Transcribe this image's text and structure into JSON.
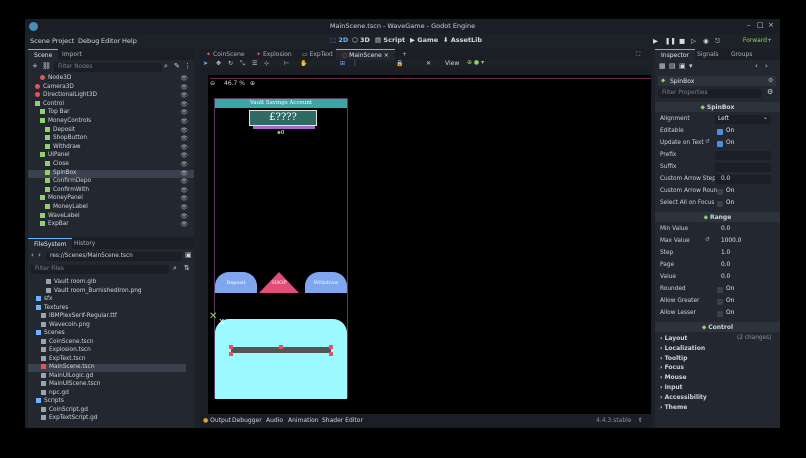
{
  "window": {
    "title": "MainScene.tscn - WaveGame - Godot Engine"
  },
  "menu": [
    "Scene",
    "Project",
    "Debug",
    "Editor",
    "Help"
  ],
  "modes": {
    "m2d": "2D",
    "m3d": "3D",
    "script": "Script",
    "game": "Game",
    "assetlib": "AssetLib"
  },
  "renderer": "Forward+",
  "scene_dock": {
    "tabs": [
      "Scene",
      "Import"
    ],
    "filter_placeholder": "Filter Nodes",
    "nodes": [
      {
        "label": "Node3D",
        "color": "#e05757"
      },
      {
        "label": "Camera3D",
        "color": "#e05757"
      },
      {
        "label": "DirectionalLight3D",
        "color": "#e05757"
      },
      {
        "label": "Control",
        "color": "#8fd16b"
      },
      {
        "label": "Top Bar",
        "color": "#8fd16b"
      },
      {
        "label": "MoneyControls",
        "color": "#8fd16b"
      },
      {
        "label": "Deposit",
        "color": "#8fd16b"
      },
      {
        "label": "ShopButton",
        "color": "#8fd16b"
      },
      {
        "label": "Withdraw",
        "color": "#8fd16b"
      },
      {
        "label": "UIPanel",
        "color": "#8fd16b"
      },
      {
        "label": "Close",
        "color": "#8fd16b"
      },
      {
        "label": "SpinBox",
        "color": "#8fd16b"
      },
      {
        "label": "ConfirmDepo",
        "color": "#8fd16b"
      },
      {
        "label": "ConfirmWith",
        "color": "#8fd16b"
      },
      {
        "label": "MoneyPanel",
        "color": "#8fd16b"
      },
      {
        "label": "MoneyLabel",
        "color": "#8fd16b"
      },
      {
        "label": "WaveLabel",
        "color": "#8fd16b"
      },
      {
        "label": "ExpBar",
        "color": "#8fd16b"
      }
    ]
  },
  "filesystem": {
    "tabs": [
      "FileSystem",
      "History"
    ],
    "path": "res://Scenes/MainScene.tscn",
    "filter_placeholder": "Filter Files",
    "items": [
      {
        "label": "Vault room.glb"
      },
      {
        "label": "Vault room_BurnishedIron.png"
      },
      {
        "label": "sfx"
      },
      {
        "label": "Textures"
      },
      {
        "label": "IBMPlexSerif-Regular.ttf"
      },
      {
        "label": "Wavecoin.png"
      },
      {
        "label": "Scenes"
      },
      {
        "label": "CoinScene.tscn"
      },
      {
        "label": "Explosion.tscn"
      },
      {
        "label": "ExpText.tscn"
      },
      {
        "label": "MainScene.tscn"
      },
      {
        "label": "MainUILogic.gd"
      },
      {
        "label": "MainUIScene.tscn"
      },
      {
        "label": "npc.gd"
      },
      {
        "label": "Scripts"
      },
      {
        "label": "CoinScript.gd"
      },
      {
        "label": "ExpTextScript.gd"
      }
    ]
  },
  "editor_tabs": [
    "CoinScene",
    "Explosion",
    "ExpText",
    "MainScene"
  ],
  "viewport": {
    "zoom": "46.7 %",
    "view_label": "View",
    "game": {
      "header": "Vault Savings Account",
      "amount": "£????",
      "spin_value": "0",
      "buttons": [
        "Deposit",
        "SHOP",
        "Withdraw"
      ]
    }
  },
  "bottom_panel": {
    "items": [
      "Output",
      "Debugger",
      "Audio",
      "Animation",
      "Shader Editor"
    ],
    "version": "4.4.3.stable"
  },
  "inspector": {
    "tabs": [
      "Inspector",
      "Signals",
      "Groups"
    ],
    "node_name": "SpinBox",
    "filter_placeholder": "Filter Properties",
    "section_title": "SpinBox",
    "props": {
      "alignment": {
        "label": "Alignment",
        "value": "Left"
      },
      "editable": {
        "label": "Editable",
        "value": "On"
      },
      "update_on_text": {
        "label": "Update on Text",
        "value": "On"
      },
      "prefix": {
        "label": "Prefix"
      },
      "suffix": {
        "label": "Suffix"
      },
      "custom_arrow_step": {
        "label": "Custom Arrow Step",
        "value": "0.0"
      },
      "custom_arrow_round": {
        "label": "Custom Arrow Roun",
        "value": "On"
      },
      "select_all": {
        "label": "Select All on Focus",
        "value": "On"
      }
    },
    "range_title": "Range",
    "range": {
      "min": {
        "label": "Min Value",
        "value": "0.0"
      },
      "max": {
        "label": "Max Value",
        "value": "1000.0"
      },
      "step": {
        "label": "Step",
        "value": "1.0"
      },
      "page": {
        "label": "Page",
        "value": "0.0"
      },
      "value": {
        "label": "Value",
        "value": "0.0"
      },
      "rounded": {
        "label": "Rounded",
        "value": "On"
      },
      "allow_greater": {
        "label": "Allow Greater",
        "value": "On"
      },
      "allow_lesser": {
        "label": "Allow Lesser",
        "value": "On"
      }
    },
    "control_title": "Control",
    "categories": [
      "Layout",
      "Localization",
      "Tooltip",
      "Focus",
      "Mouse",
      "Input",
      "Accessibility",
      "Theme"
    ],
    "layout_note": "(2 changes)"
  },
  "colors": {
    "accent": "#6fb3ff",
    "teal": "#3aa6a6",
    "cyan_panel": "#9cf9ff",
    "shop": "#e44d7a"
  }
}
